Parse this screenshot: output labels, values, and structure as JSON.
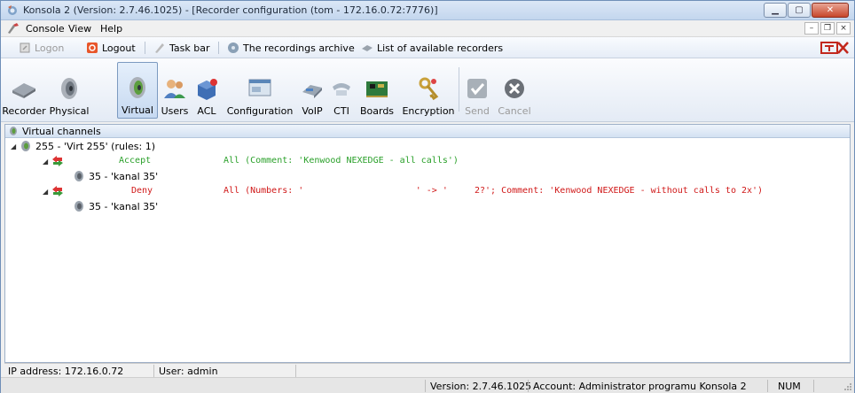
{
  "window": {
    "title": "Konsola 2 (Version:  2.7.46.1025) - [Recorder configuration (tom - 172.16.0.72:7776)]"
  },
  "menu": {
    "items": [
      "Console",
      "View",
      "Help"
    ]
  },
  "linkbar": {
    "logon": "Logon",
    "logout": "Logout",
    "taskbar": "Task bar",
    "archive": "The recordings archive",
    "recorders": "List of available recorders"
  },
  "toolbar": {
    "recorder": "Recorder",
    "physical": "Physical",
    "virtual": "Virtual",
    "users": "Users",
    "acl": "ACL",
    "configuration": "Configuration",
    "voip": "VoIP",
    "cti": "CTI",
    "boards": "Boards",
    "encryption": "Encryption",
    "send": "Send",
    "cancel": "Cancel"
  },
  "tree": {
    "header": "Virtual channels",
    "root": "255 - 'Virt 255' (rules: 1)",
    "rules": [
      {
        "name": "Accept",
        "detail": "All (Comment: 'Kenwood NEXEDGE - all calls')",
        "color": "#2aa02a",
        "channel": "35 - 'kanal 35'"
      },
      {
        "name": "Deny",
        "detail": "All (Numbers: '                     ' -> '     2?'; Comment: 'Kenwood NEXEDGE - without calls to 2x')",
        "color": "#d01818",
        "channel": "35 - 'kanal 35'"
      }
    ]
  },
  "status": {
    "ip": "IP address: 172.16.0.72",
    "user": "User: admin",
    "version": "Version: 2.7.46.1025",
    "account": "Account: Administrator programu Konsola 2",
    "num": "NUM"
  }
}
